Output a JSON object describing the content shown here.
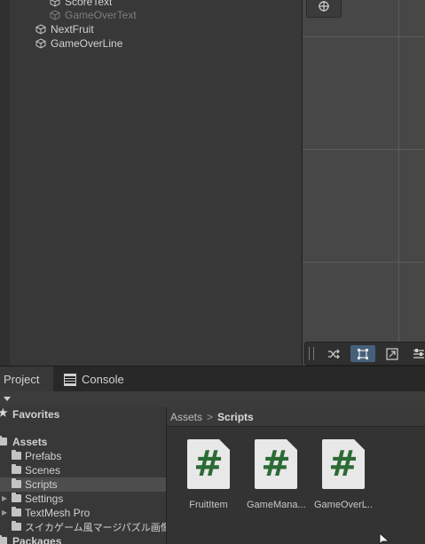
{
  "hierarchy": {
    "items": [
      {
        "label": "ScoreText",
        "dim": false
      },
      {
        "label": "GameOverText",
        "dim": true
      },
      {
        "label": "NextFruit",
        "dim": false
      },
      {
        "label": "GameOverLine",
        "dim": false
      }
    ]
  },
  "tabs": {
    "project": "Project",
    "console": "Console"
  },
  "tree": {
    "favorites": "Favorites",
    "assets": "Assets",
    "folders": [
      "Prefabs",
      "Scenes",
      "Scripts",
      "Settings",
      "TextMesh Pro",
      "スイカゲーム風マージパズル画像素材"
    ],
    "packages": "Packages"
  },
  "breadcrumb": {
    "root": "Assets",
    "separator": ">",
    "current": "Scripts"
  },
  "assets": [
    {
      "icon": "#",
      "label": "FruitItem"
    },
    {
      "icon": "#",
      "label": "GameMana..."
    },
    {
      "icon": "#",
      "label": "GameOverL..."
    }
  ]
}
